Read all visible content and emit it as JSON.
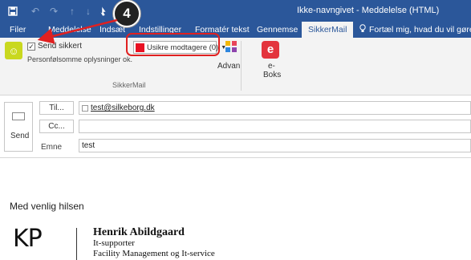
{
  "window": {
    "title": "Ikke-navngivet - Meddelelse (HTML)"
  },
  "quick_access": {
    "icons": [
      "save-icon",
      "undo-icon",
      "redo-icon",
      "up-icon",
      "down-icon",
      "cursor-icon"
    ]
  },
  "tabs": [
    {
      "label": "Filer"
    },
    {
      "label": "Meddelelse"
    },
    {
      "label": "Indsæt"
    },
    {
      "label": "Indstillinger"
    },
    {
      "label": "Formatér tekst"
    },
    {
      "label": "Gennemse"
    },
    {
      "label": "SikkerMail",
      "active": true
    }
  ],
  "tell_me": "Fortæl mig, hvad du vil gøre",
  "ribbon": {
    "send_sikkert_label": "Send sikkert",
    "send_sikkert_checked": true,
    "personal_info_label": "Personfølsomme oplysninger ok.",
    "unsafe_recipients_label": "Usikre modtagere (0)",
    "advan_label": "Advan",
    "eboks_icon_letter": "e",
    "eboks_label_line1": "e-",
    "eboks_label_line2": "Boks",
    "group_label": "SikkerMail",
    "accent_red": "#e81123"
  },
  "step_badge": "4",
  "compose": {
    "send_label": "Send",
    "to_button": "Til...",
    "cc_button": "Cc...",
    "to_value": "test@silkeborg.dk",
    "cc_value": "",
    "subject_label": "Emne",
    "subject_value": "test"
  },
  "body": {
    "greeting": "Med venlig hilsen",
    "logo_text": "KP",
    "signature_name": "Henrik Abildgaard",
    "signature_role": "It-supporter",
    "signature_dept": "Facility Management og It-service"
  }
}
